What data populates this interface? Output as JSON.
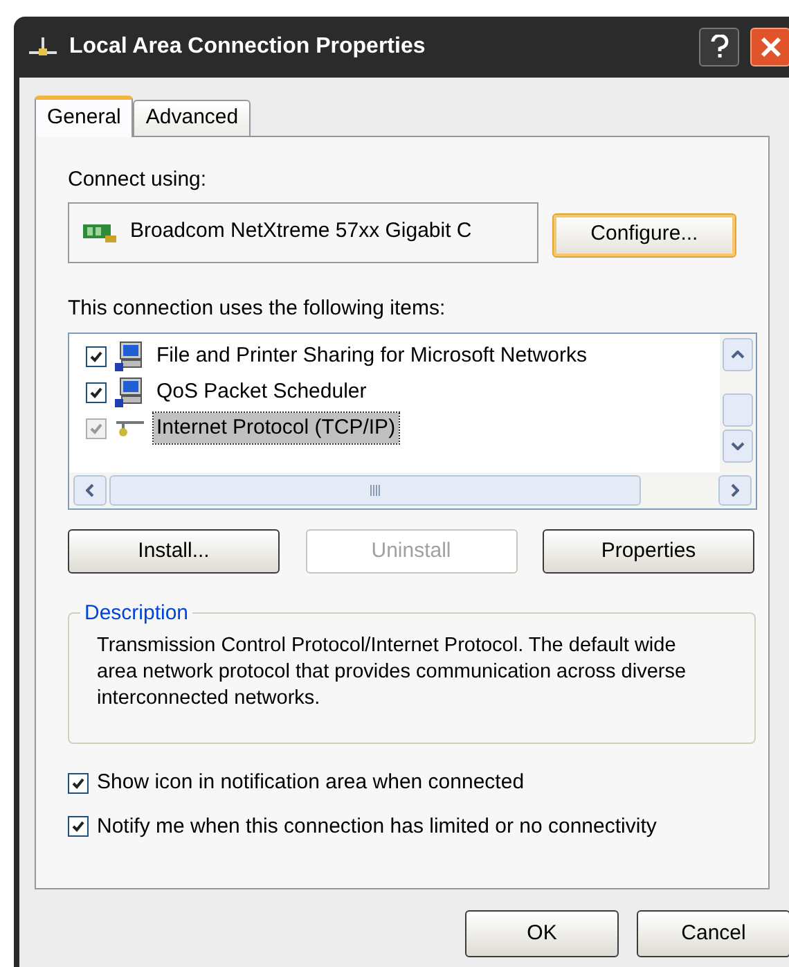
{
  "window": {
    "title": "Local Area Connection Properties"
  },
  "tabs": [
    {
      "label": "General",
      "selected": true
    },
    {
      "label": "Advanced",
      "selected": false
    }
  ],
  "connect_using": {
    "label": "Connect using:",
    "adapter": "Broadcom NetXtreme 57xx Gigabit C",
    "configure_button": "Configure..."
  },
  "items_label": "This connection uses the following items:",
  "items": [
    {
      "label": "File and Printer Sharing for Microsoft Networks",
      "checked": true,
      "selected": false,
      "disabled": false,
      "kind": "computer"
    },
    {
      "label": "QoS Packet Scheduler",
      "checked": true,
      "selected": false,
      "disabled": false,
      "kind": "computer"
    },
    {
      "label": "Internet Protocol (TCP/IP)",
      "checked": true,
      "selected": true,
      "disabled": true,
      "kind": "protocol"
    }
  ],
  "item_buttons": [
    {
      "label": "Install...",
      "disabled": false
    },
    {
      "label": "Uninstall",
      "disabled": true
    },
    {
      "label": "Properties",
      "disabled": false
    }
  ],
  "description": {
    "title": "Description",
    "text": "Transmission Control Protocol/Internet Protocol. The default wide area network protocol that provides communication across diverse interconnected networks."
  },
  "options": [
    {
      "label": "Show icon in notification area when connected",
      "checked": true
    },
    {
      "label": "Notify me when this connection has limited or no connectivity",
      "checked": true
    }
  ],
  "buttons": [
    {
      "label": "OK"
    },
    {
      "label": "Cancel"
    }
  ]
}
